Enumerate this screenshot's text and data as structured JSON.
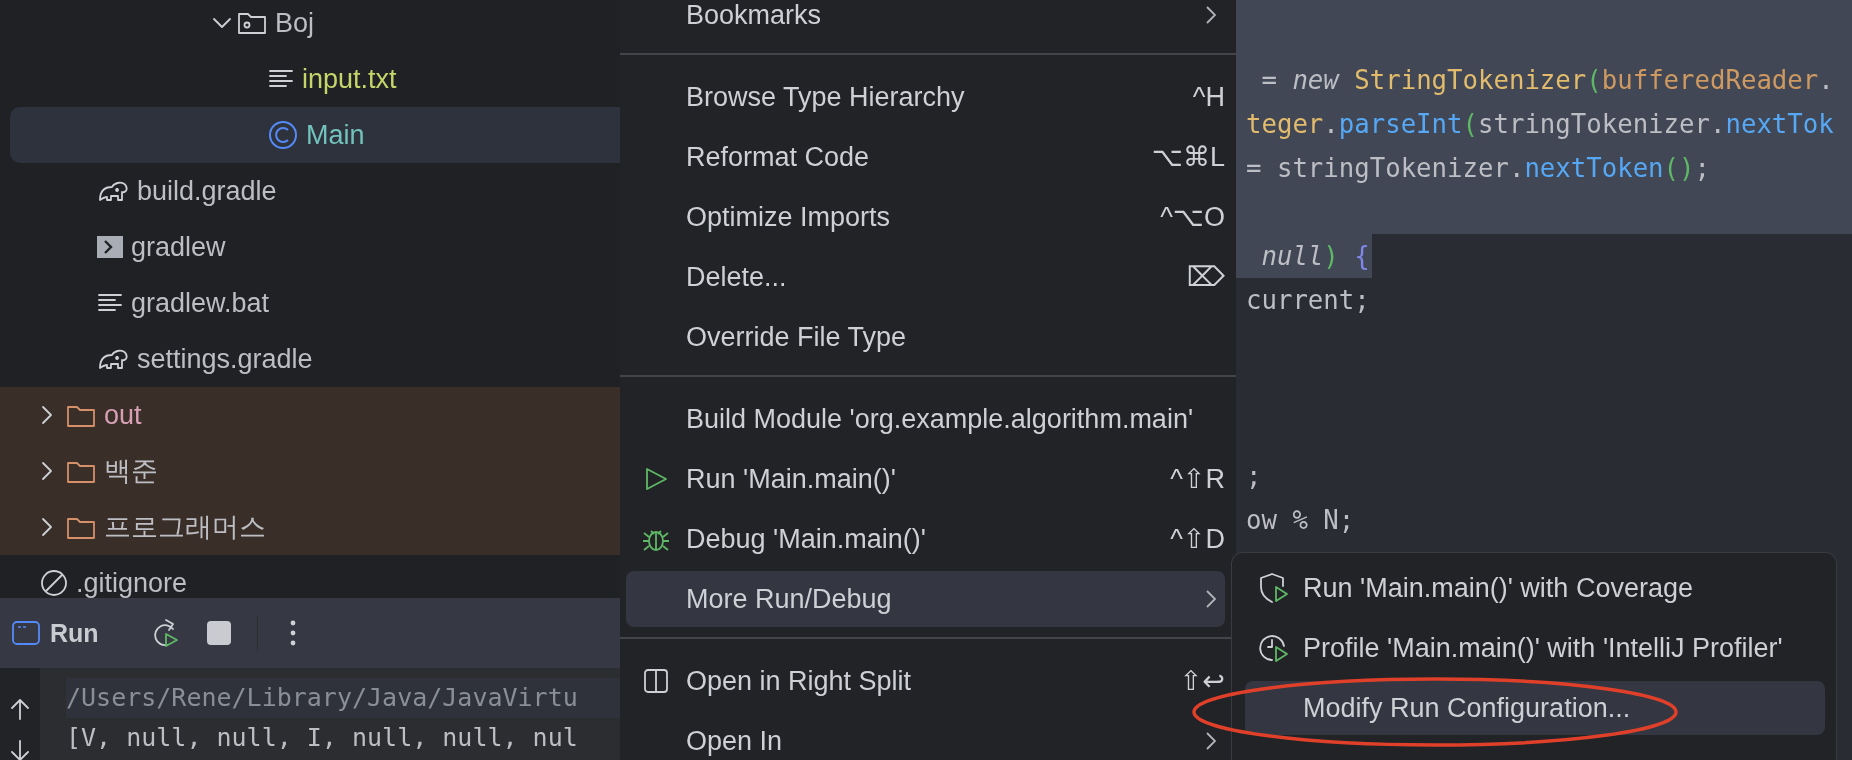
{
  "project_tree": {
    "items": [
      {
        "children": [
          {
            "children": [
              {
                "children": [
                  {
                    "label": "Boj",
                    "kind": "package-folder",
                    "expanded": true,
                    "selected": false,
                    "excluded": false,
                    "color": "#bcbec4",
                    "children": [
                      {
                        "label": "input.txt",
                        "kind": "text",
                        "selected": false,
                        "excluded": false,
                        "color": "#c5d56a"
                      },
                      {
                        "label": "Main",
                        "kind": "class",
                        "selected": true,
                        "excluded": false,
                        "color": "#72c3bd"
                      }
                    ]
                  }
                ]
              }
            ]
          },
          {
            "label": "build.gradle",
            "kind": "gradle",
            "selected": false,
            "excluded": false,
            "color": "#bcbec4"
          },
          {
            "label": "gradlew",
            "kind": "script",
            "selected": false,
            "excluded": false,
            "color": "#bcbec4"
          },
          {
            "label": "gradlew.bat",
            "kind": "text",
            "selected": false,
            "excluded": false,
            "color": "#bcbec4"
          },
          {
            "label": "settings.gradle",
            "kind": "gradle",
            "selected": false,
            "excluded": false,
            "color": "#bcbec4"
          }
        ]
      },
      {
        "label": "out",
        "kind": "folder",
        "expanded": false,
        "selected": false,
        "excluded": true,
        "color": "#d79fb4"
      },
      {
        "label": "백준",
        "kind": "folder",
        "expanded": false,
        "selected": false,
        "excluded": true,
        "color": "#bcbec4"
      },
      {
        "label": "프로그래머스",
        "kind": "folder",
        "expanded": false,
        "selected": false,
        "excluded": true,
        "color": "#bcbec4"
      },
      {
        "label": ".gitignore",
        "kind": "ignore",
        "selected": false,
        "excluded": false,
        "color": "#bcbec4"
      }
    ]
  },
  "run_panel": {
    "title": "Run",
    "console_lines": [
      {
        "text": "/Users/Rene/Library/Java/JavaVirtu",
        "current": true
      },
      {
        "text": "[V, null, null, I, null, null, nul",
        "current": false
      }
    ]
  },
  "context_menu": {
    "items": [
      {
        "kind": "item",
        "label": "Bookmarks",
        "submenu": true,
        "selected": false
      },
      {
        "kind": "separator"
      },
      {
        "kind": "item",
        "label": "Browse Type Hierarchy",
        "shortcut": "^H",
        "selected": false
      },
      {
        "kind": "item",
        "label": "Reformat Code",
        "shortcut": "⌥⌘L",
        "selected": false
      },
      {
        "kind": "item",
        "label": "Optimize Imports",
        "shortcut": "^⌥O",
        "selected": false
      },
      {
        "kind": "item",
        "label": "Delete...",
        "shortcut": "⌦",
        "selected": false
      },
      {
        "kind": "item",
        "label": "Override File Type",
        "selected": false
      },
      {
        "kind": "separator"
      },
      {
        "kind": "item",
        "label": "Build Module 'org.example.algorithm.main'",
        "selected": false
      },
      {
        "kind": "run",
        "label": "Run 'Main.main()'",
        "shortcut": "^⇧R",
        "selected": false
      },
      {
        "kind": "debug",
        "label": "Debug 'Main.main()'",
        "shortcut": "^⇧D",
        "selected": false
      },
      {
        "kind": "item",
        "label": "More Run/Debug",
        "submenu": true,
        "selected": true,
        "open": true
      },
      {
        "kind": "separator"
      },
      {
        "kind": "split",
        "label": "Open in Right Split",
        "shortcut": "⇧↩",
        "selected": false
      },
      {
        "kind": "item",
        "label": "Open In",
        "submenu": true,
        "selected": false
      }
    ]
  },
  "submenu": {
    "items": [
      {
        "kind": "coverage",
        "label": "Run 'Main.main()' with Coverage",
        "selected": false
      },
      {
        "kind": "profiler",
        "label": "Profile 'Main.main()' with 'IntelliJ Profiler'",
        "selected": false
      },
      {
        "kind": "item",
        "label": "Modify Run Configuration...",
        "selected": true
      }
    ]
  },
  "editor": {
    "lines": [
      {
        "selected": true,
        "to_line_end": true
      },
      {
        "selected": true,
        "to_line_end": true
      },
      {
        "selected": true,
        "to_line_end": true,
        "tokens": [
          {
            "t": " = *new* ",
            "color": "#bcbec4"
          },
          {
            "t": "StringTokenizer",
            "color": "#e2bc6c"
          },
          {
            "t": "(",
            "color": "#5fb865"
          },
          {
            "t": "bufferedReader",
            "color": "#cf9a62"
          },
          {
            "t": ".",
            "color": "#bcbec4"
          }
        ]
      },
      {
        "selected": true,
        "to_line_end": true,
        "tokens": [
          {
            "t": "teger",
            "color": "#e2bc6c"
          },
          {
            "t": ".",
            "color": "#bcbec4"
          },
          {
            "t": "parseInt",
            "color": "#56a8f5"
          },
          {
            "t": "(",
            "color": "#5fb865"
          },
          {
            "t": "stringTokenizer.",
            "color": "#bcbec4"
          },
          {
            "t": "nextTok",
            "color": "#56a8f5"
          }
        ]
      },
      {
        "selected": true,
        "to_line_end": true,
        "tokens": [
          {
            "t": "= stringTokenizer.",
            "color": "#bcbec4"
          },
          {
            "t": "nextToken",
            "color": "#56a8f5"
          },
          {
            "t": "()",
            "color": "#5fb865"
          },
          {
            "t": ";",
            "color": "#bcbec4"
          }
        ]
      },
      {
        "selected": true,
        "to_line_end": true
      },
      {
        "selected": true,
        "to_line_end": false,
        "tokens": [
          {
            "t": " *null*",
            "color": "#bcbec4"
          },
          {
            "t": ")",
            "color": "#5fb865"
          },
          {
            "t": " {",
            "color": "#7f86e6"
          }
        ]
      },
      {
        "selected": false,
        "tokens": [
          {
            "t": "current;",
            "color": "#bcbec4"
          }
        ]
      },
      {
        "selected": false
      },
      {
        "selected": false
      },
      {
        "selected": false
      },
      {
        "selected": false,
        "tokens": [
          {
            "t": ";",
            "color": "#bcbec4"
          }
        ]
      },
      {
        "selected": false,
        "tokens": [
          {
            "t": "ow % N;",
            "color": "#bcbec4"
          }
        ]
      }
    ]
  },
  "annotations": [
    {
      "kind": "ellipse"
    }
  ]
}
